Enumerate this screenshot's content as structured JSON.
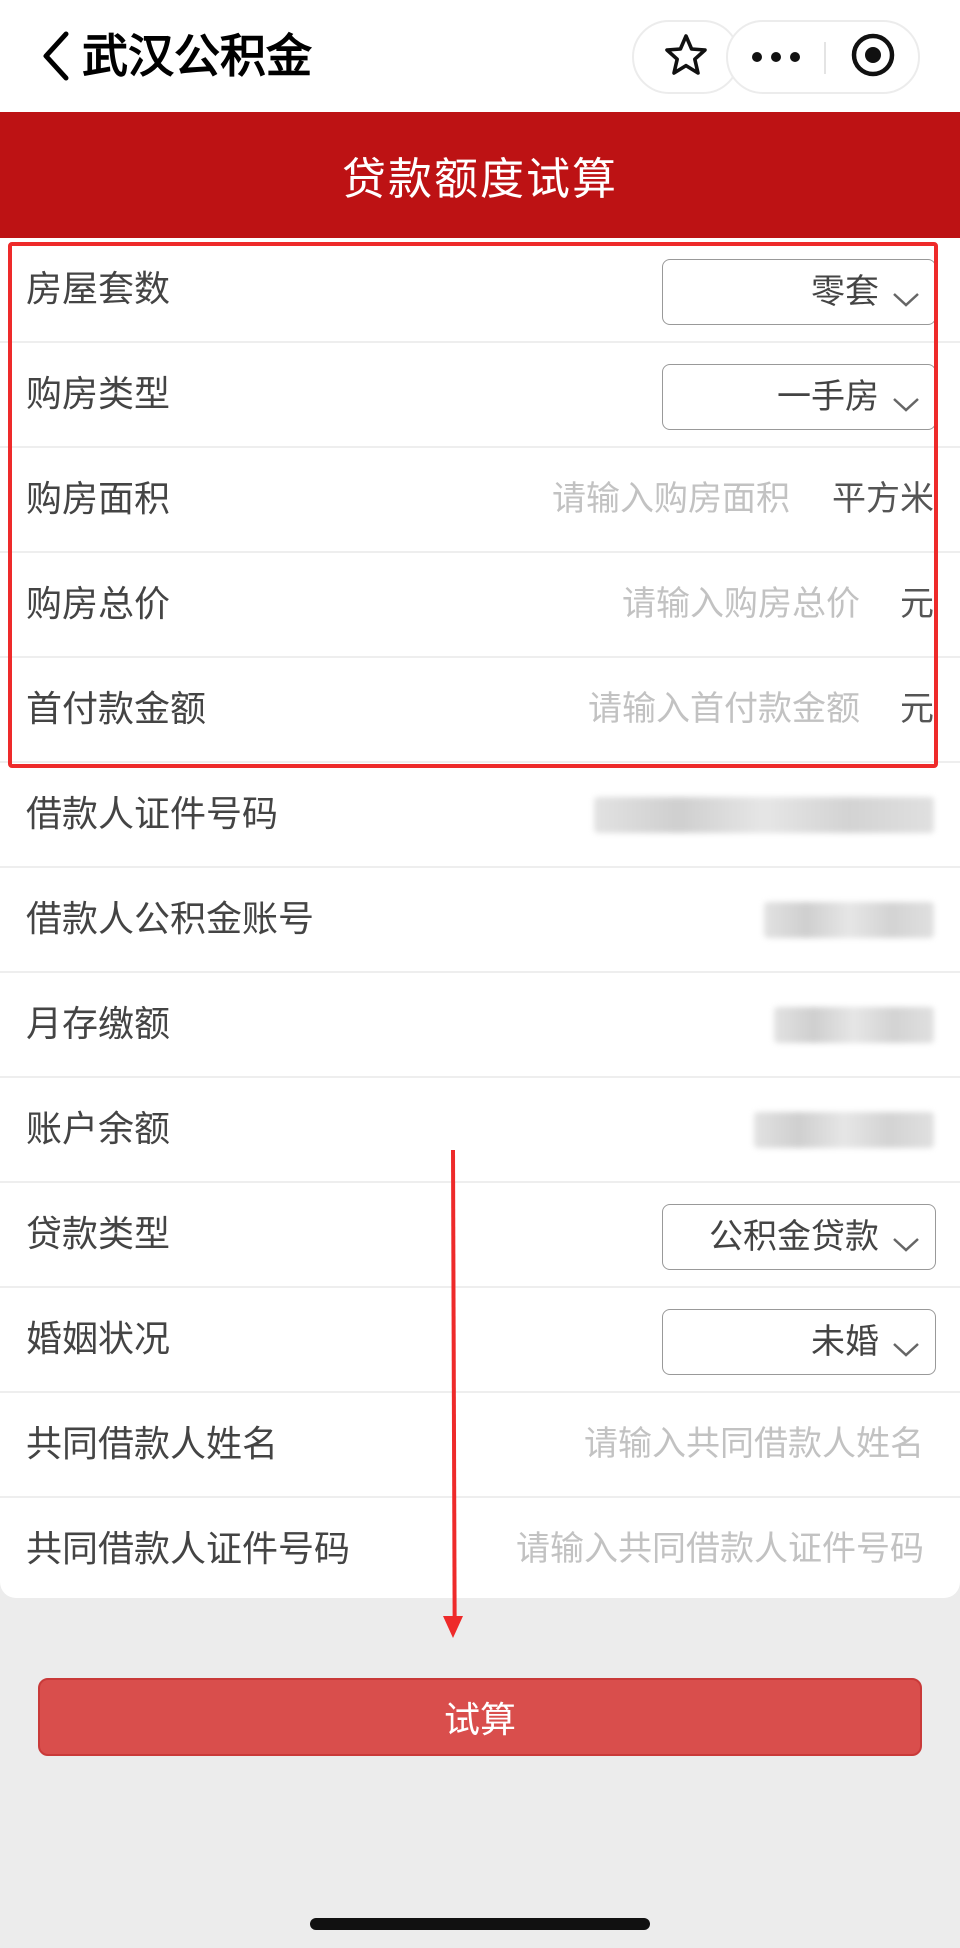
{
  "nav": {
    "title": "武汉公积金",
    "back_icon": "chevron-left-icon",
    "star_icon": "star-icon",
    "more_icon": "more-dots-icon",
    "close_icon": "target-icon"
  },
  "header": {
    "title": "贷款额度试算"
  },
  "form": {
    "house_count": {
      "label": "房屋套数",
      "value": "零套"
    },
    "purchase_type": {
      "label": "购房类型",
      "value": "一手房"
    },
    "area": {
      "label": "购房面积",
      "placeholder": "请输入购房面积",
      "unit": "平方米"
    },
    "total_price": {
      "label": "购房总价",
      "placeholder": "请输入购房总价",
      "unit": "元"
    },
    "down_payment": {
      "label": "首付款金额",
      "placeholder": "请输入首付款金额",
      "unit": "元"
    },
    "id_number": {
      "label": "借款人证件号码"
    },
    "account_number": {
      "label": "借款人公积金账号"
    },
    "monthly_deposit": {
      "label": "月存缴额"
    },
    "balance": {
      "label": "账户余额"
    },
    "loan_type": {
      "label": "贷款类型",
      "value": "公积金贷款"
    },
    "marital_status": {
      "label": "婚姻状况",
      "value": "未婚"
    },
    "co_borrower_name": {
      "label": "共同借款人姓名",
      "placeholder": "请输入共同借款人姓名"
    },
    "co_borrower_id": {
      "label": "共同借款人证件号码",
      "placeholder": "请输入共同借款人证件号码"
    }
  },
  "submit": {
    "label": "试算"
  },
  "colors": {
    "header_red": "#bd1214",
    "button_red": "#d94e4c",
    "annotation_red": "#ee2a2a"
  }
}
